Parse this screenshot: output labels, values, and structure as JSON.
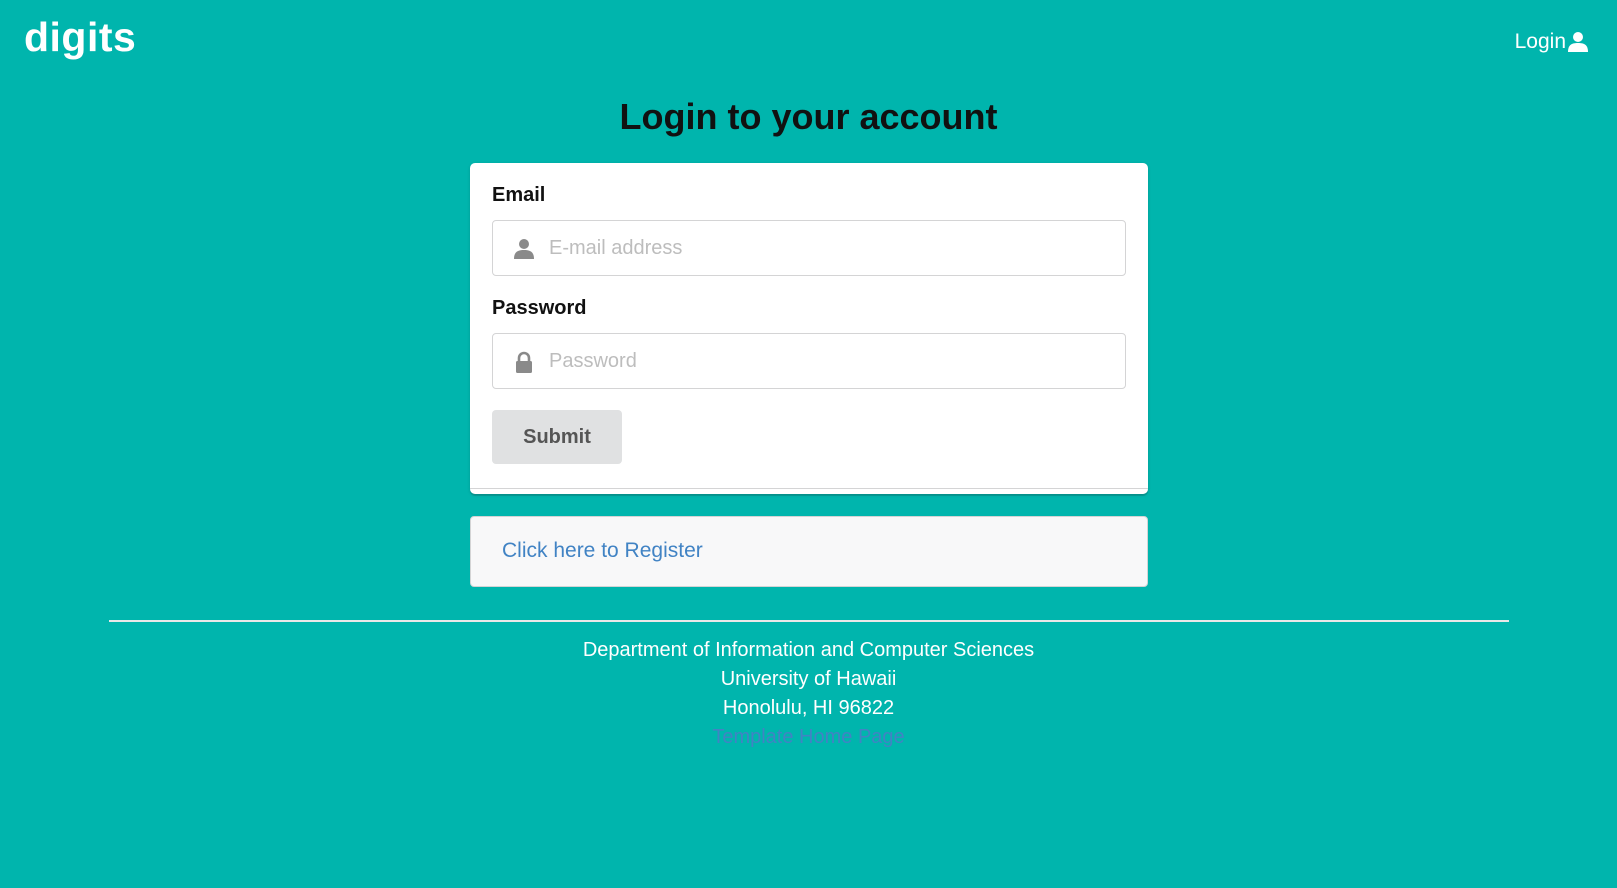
{
  "navbar": {
    "brand": "digits",
    "login_label": "Login"
  },
  "page": {
    "title": "Login to your account"
  },
  "form": {
    "email_label": "Email",
    "email_placeholder": "E-mail address",
    "email_icon": "user-icon",
    "password_label": "Password",
    "password_placeholder": "Password",
    "password_icon": "lock-icon",
    "submit_label": "Submit"
  },
  "register": {
    "link_text": "Click here to Register"
  },
  "footer": {
    "line1": "Department of Information and Computer Sciences",
    "line2": "University of Hawaii",
    "line3": "Honolulu, HI 96822",
    "link_text": "Template Home Page"
  },
  "colors": {
    "background": "#00b5ad",
    "link": "#4183c4",
    "button": "#e0e1e2"
  }
}
